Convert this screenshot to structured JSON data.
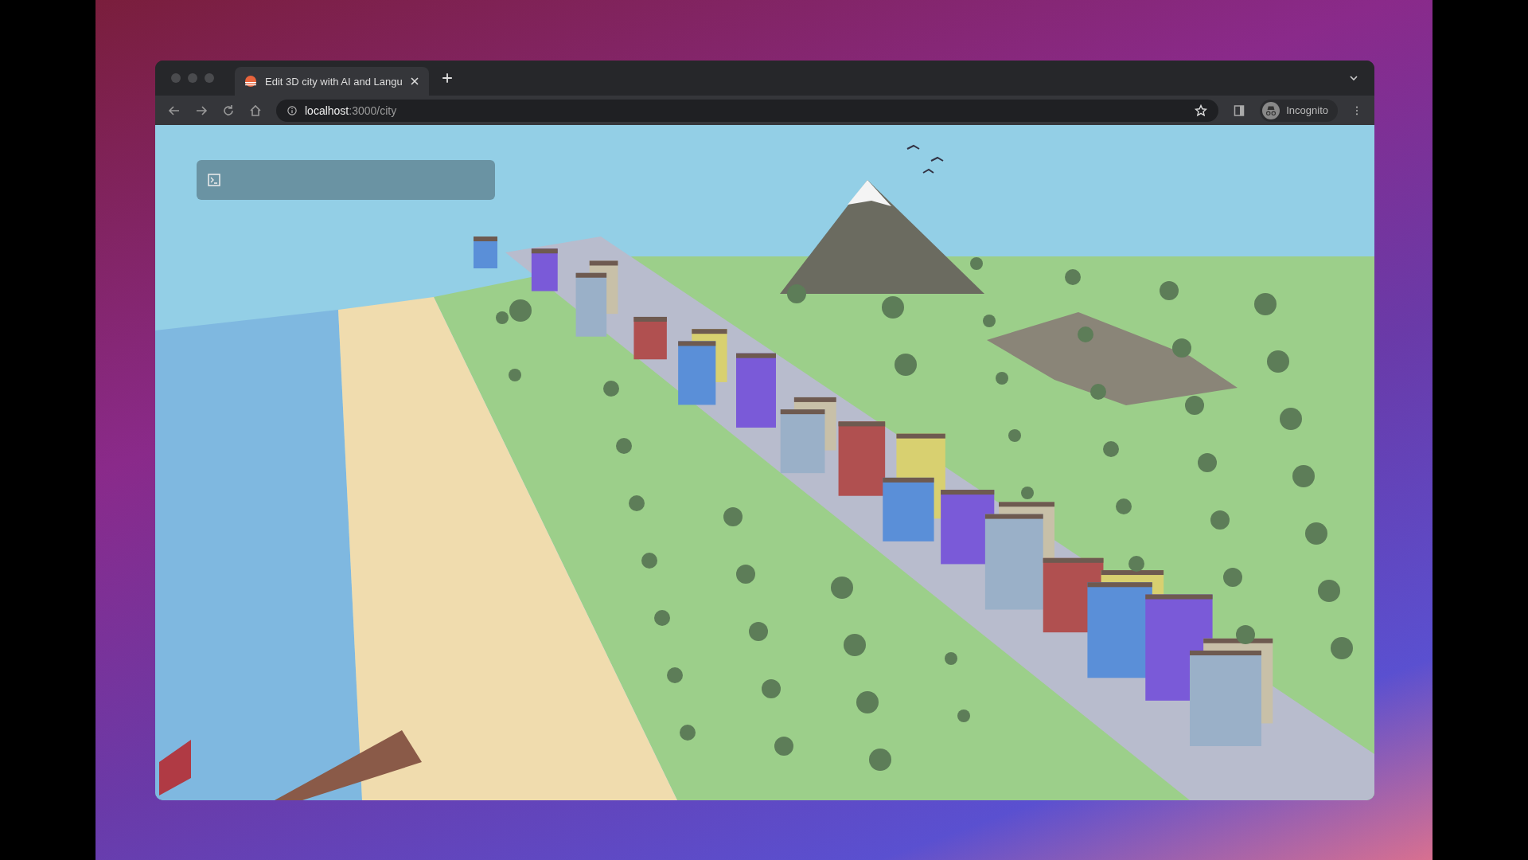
{
  "browser": {
    "tabs": [
      {
        "title": "Edit 3D city with AI and Langu",
        "selected": true
      }
    ],
    "address_bar": {
      "host": "localhost",
      "path": ":3000/city"
    },
    "profile": {
      "label": "Incognito"
    }
  }
}
